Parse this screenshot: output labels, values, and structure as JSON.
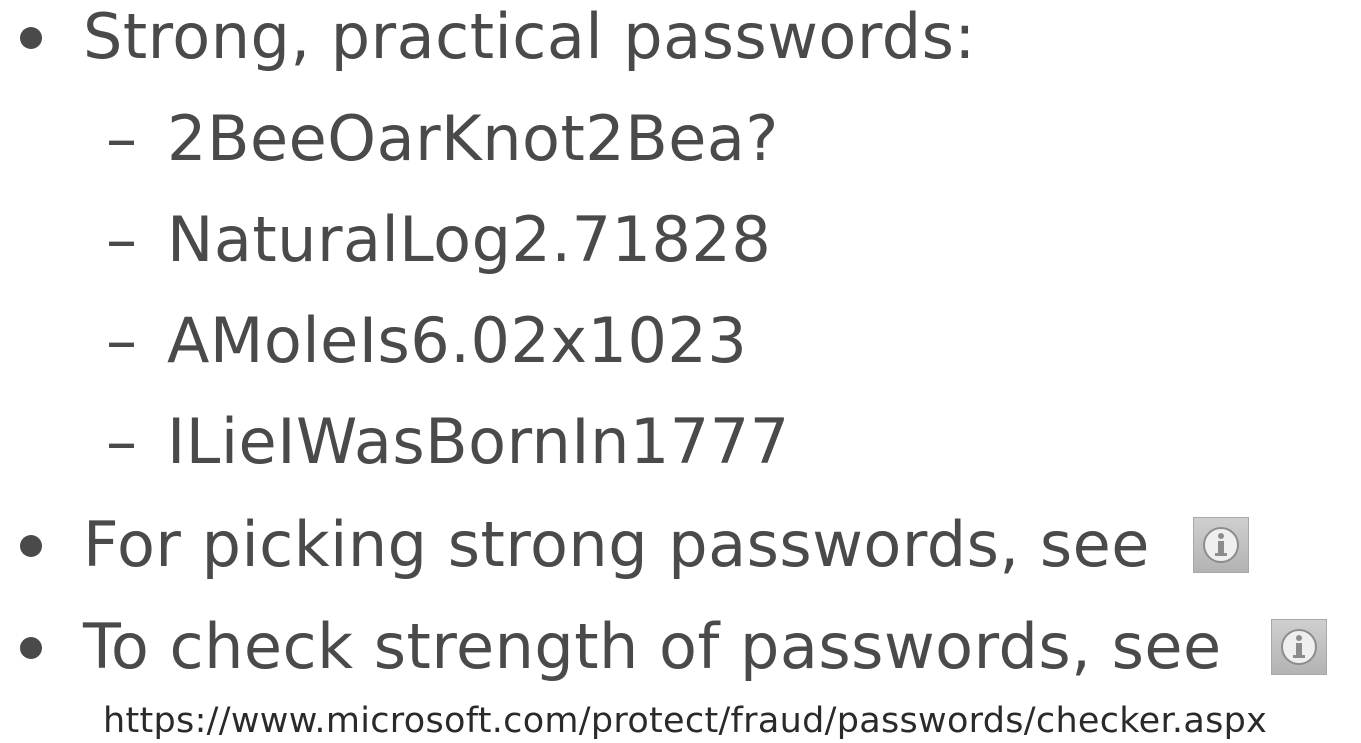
{
  "slide": {
    "bullets": [
      {
        "text": "Strong, practical passwords:",
        "sub_items": [
          "2BeeOarKnot2Bea?",
          "NaturalLog2.71828",
          "AMoleIs6.02x1023",
          "ILieIWasBornIn1777"
        ]
      },
      {
        "text": "For picking strong passwords, see",
        "icon": "info-icon"
      },
      {
        "text": "To check strength of passwords, see",
        "icon": "info-icon"
      }
    ],
    "url": "https://www.microsoft.com/protect/fraud/passwords/checker.aspx",
    "colors": {
      "text": "#4a4a4a",
      "icon_bg": "#c0c0c0"
    }
  }
}
